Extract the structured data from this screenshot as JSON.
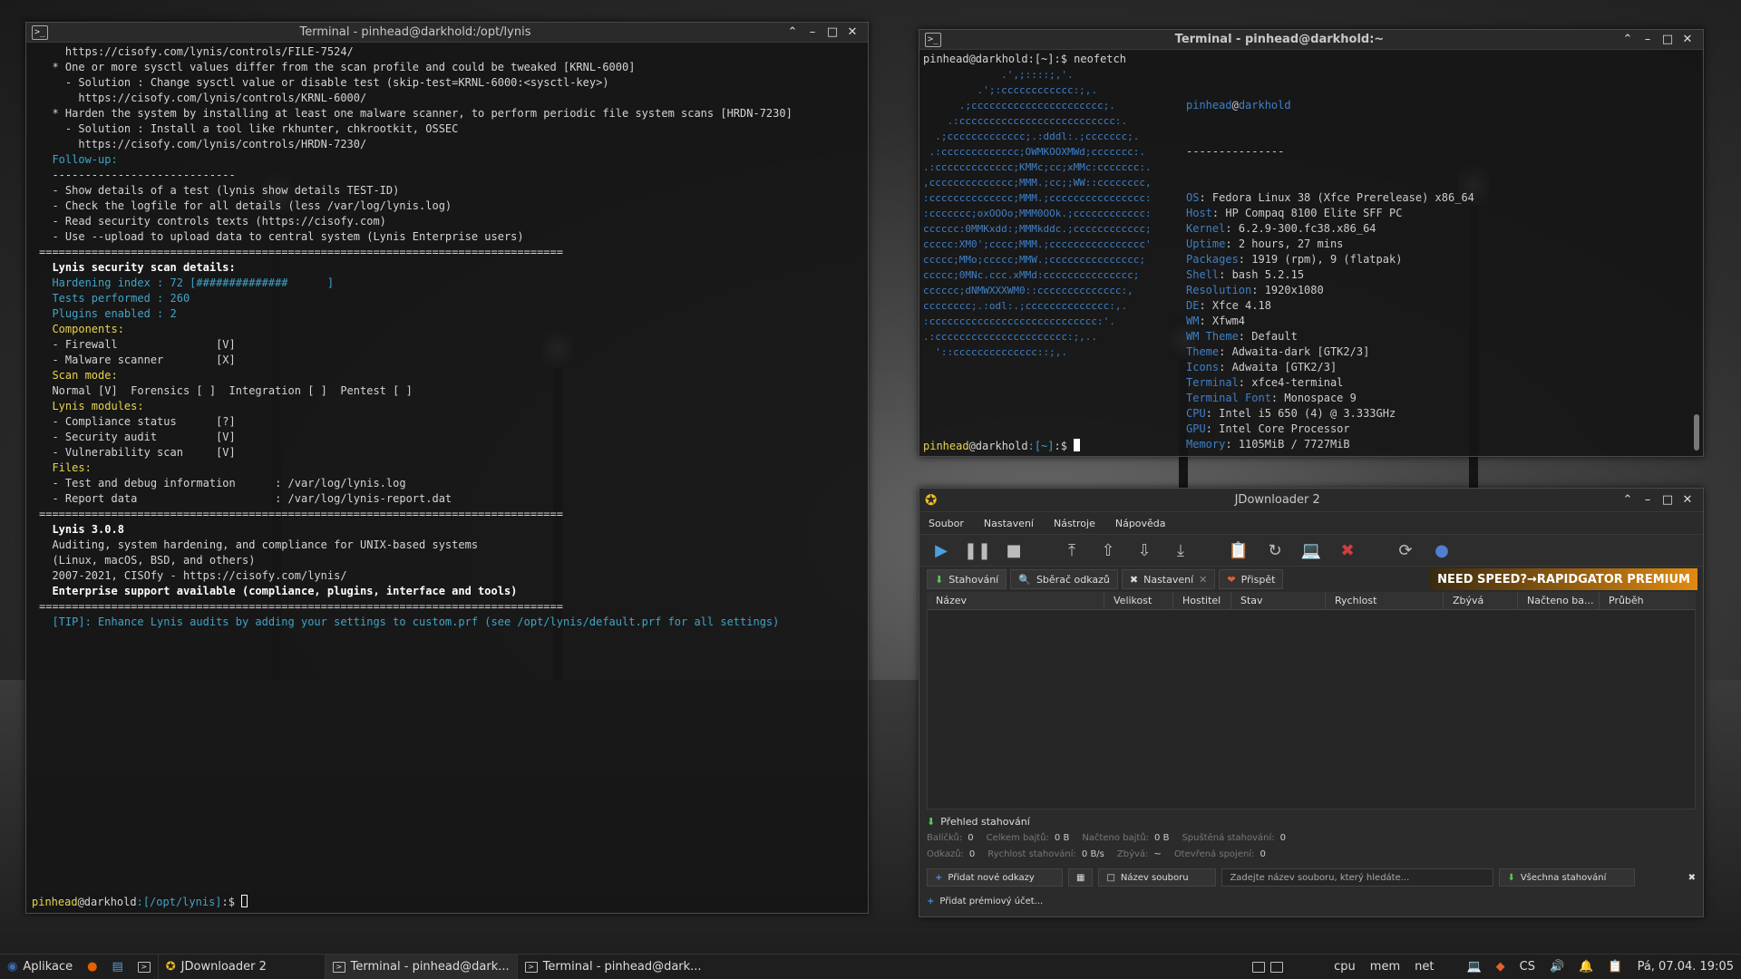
{
  "term_left": {
    "title": "Terminal - pinhead@darkhold:/opt/lynis",
    "lines": [
      "    https://cisofy.com/lynis/controls/FILE-7524/",
      "",
      "  * One or more sysctl values differ from the scan profile and could be tweaked [KRNL-6000]",
      "    - Solution : Change sysctl value or disable test (skip-test=KRNL-6000:<sysctl-key>)",
      "      https://cisofy.com/lynis/controls/KRNL-6000/",
      "",
      "  * Harden the system by installing at least one malware scanner, to perform periodic file system scans [HRDN-7230]",
      "    - Solution : Install a tool like rkhunter, chkrootkit, OSSEC",
      "      https://cisofy.com/lynis/controls/HRDN-7230/",
      "",
      "  Follow-up:",
      "  ----------------------------",
      "  - Show details of a test (lynis show details TEST-ID)",
      "  - Check the logfile for all details (less /var/log/lynis.log)",
      "  - Read security controls texts (https://cisofy.com)",
      "  - Use --upload to upload data to central system (Lynis Enterprise users)",
      "",
      "================================================================================",
      "",
      "  Lynis security scan details:",
      "",
      "  Hardening index : 72 [##############      ]",
      "  Tests performed : 260",
      "  Plugins enabled : 2",
      "",
      "  Components:",
      "  - Firewall               [V]",
      "  - Malware scanner        [X]",
      "",
      "  Scan mode:",
      "  Normal [V]  Forensics [ ]  Integration [ ]  Pentest [ ]",
      "",
      "  Lynis modules:",
      "  - Compliance status      [?]",
      "  - Security audit         [V]",
      "  - Vulnerability scan     [V]",
      "",
      "  Files:",
      "  - Test and debug information      : /var/log/lynis.log",
      "  - Report data                     : /var/log/lynis-report.dat",
      "",
      "================================================================================",
      "",
      "  Lynis 3.0.8",
      "",
      "  Auditing, system hardening, and compliance for UNIX-based systems",
      "  (Linux, macOS, BSD, and others)",
      "",
      "  2007-2021, CISOfy - https://cisofy.com/lynis/",
      "  Enterprise support available (compliance, plugins, interface and tools)",
      "",
      "================================================================================",
      "",
      "  [TIP]: Enhance Lynis audits by adding your settings to custom.prf (see /opt/lynis/default.prf for all settings)"
    ],
    "prompt_user": "pinhead",
    "prompt_host": "@darkhold",
    "prompt_path": ":[/opt/lynis]",
    "prompt_symbol": ":$ "
  },
  "term_right": {
    "title": "Terminal - pinhead@darkhold:~",
    "command_line": "pinhead@darkhold:[~]:$ neofetch",
    "logo_lines": [
      "             .',;::::;,'.",
      "         .';:cccccccccccc:;,.",
      "      .;cccccccccccccccccccccc;.",
      "    .:cccccccccccccccccccccccccc:.",
      "  .;ccccccccccccc;.:dddl:.;ccccccc;.",
      " .:ccccccccccccc;OWMKOOXMWd;ccccccc:.",
      ".:ccccccccccccc;KMMc;cc;xMMc:ccccccc:.",
      ",cccccccccccccc;MMM.;cc;;WW::cccccccc,",
      ":cccccccccccccc;MMM.;cccccccccccccccc:",
      ":ccccccc;oxOOOo;MMM0OOk.;cccccccccccc:",
      "cccccc:0MMKxdd:;MMMkddc.;cccccccccccc;",
      "ccccc:XM0';cccc;MMM.;cccccccccccccccc'",
      "ccccc;MMo;ccccc;MMW.;ccccccccccccccc;",
      "ccccc;0MNc.ccc.xMMd:ccccccccccccccc;",
      "cccccc;dNMWXXXWM0::cccccccccccccc:,",
      "cccccccc;.:odl:.;cccccccccccccc:,.",
      ":cccccccccccccccccccccccccccc:'.",
      ".:cccccccccccccccccccccc:;,..",
      "  '::cccccccccccccc::;,."
    ],
    "user": "pinhead",
    "host": "darkhold",
    "separator": "---------------",
    "info": [
      {
        "k": "OS",
        "v": "Fedora Linux 38 (Xfce Prerelease) x86_64"
      },
      {
        "k": "Host",
        "v": "HP Compaq 8100 Elite SFF PC"
      },
      {
        "k": "Kernel",
        "v": "6.2.9-300.fc38.x86_64"
      },
      {
        "k": "Uptime",
        "v": "2 hours, 27 mins"
      },
      {
        "k": "Packages",
        "v": "1919 (rpm), 9 (flatpak)"
      },
      {
        "k": "Shell",
        "v": "bash 5.2.15"
      },
      {
        "k": "Resolution",
        "v": "1920x1080"
      },
      {
        "k": "DE",
        "v": "Xfce 4.18"
      },
      {
        "k": "WM",
        "v": "Xfwm4"
      },
      {
        "k": "WM Theme",
        "v": "Default"
      },
      {
        "k": "Theme",
        "v": "Adwaita-dark [GTK2/3]"
      },
      {
        "k": "Icons",
        "v": "Adwaita [GTK2/3]"
      },
      {
        "k": "Terminal",
        "v": "xfce4-terminal"
      },
      {
        "k": "Terminal Font",
        "v": "Monospace 9"
      },
      {
        "k": "CPU",
        "v": "Intel i5 650 (4) @ 3.333GHz"
      },
      {
        "k": "GPU",
        "v": "Intel Core Processor"
      },
      {
        "k": "Memory",
        "v": "1105MiB / 7727MiB"
      }
    ],
    "swatches_top": [
      "#000000",
      "#cc0000",
      "#4e9a06",
      "#c4a000",
      "#3465a4",
      "#75507b",
      "#06989a",
      "#d3d7cf"
    ],
    "swatches_bottom": [
      "#555753",
      "#ef2929",
      "#8ae234",
      "#fce94f",
      "#729fcf",
      "#ad7fa8",
      "#34e2e2",
      "#eeeeec"
    ],
    "prompt_user": "pinhead",
    "prompt_host": "@darkhold",
    "prompt_path": ":[~]",
    "prompt_symbol": ":$ "
  },
  "jd": {
    "title": "JDownloader 2",
    "menu": [
      "Soubor",
      "Nastavení",
      "Nástroje",
      "Nápověda"
    ],
    "tabs": [
      "Stahování",
      "Sběrač odkazů",
      "Nastavení",
      "Přispět"
    ],
    "promo": "NEED SPEED?→RAPIDGATOR PREMIUM",
    "columns": [
      "Název",
      "Velikost",
      "Hostitel",
      "Stav",
      "Rychlost",
      "Zbývá",
      "Načteno ba...",
      "Průběh"
    ],
    "overview_title": "Přehled stahování",
    "stats_row1": [
      {
        "label": "Balíčků:",
        "value": "0"
      },
      {
        "label": "Celkem bajtů:",
        "value": "0 B"
      },
      {
        "label": "Načteno bajtů:",
        "value": "0 B"
      },
      {
        "label": "Spuštěná stahování:",
        "value": "0"
      }
    ],
    "stats_row2": [
      {
        "label": "Odkazů:",
        "value": "0"
      },
      {
        "label": "Rychlost stahování:",
        "value": "0 B/s"
      },
      {
        "label": "Zbývá:",
        "value": "~"
      },
      {
        "label": "Otevřená spojení:",
        "value": "0"
      }
    ],
    "add_links": "Přidat nové odkazy",
    "filename_label": "Název souboru",
    "search_placeholder": "Zadejte název souboru, který hledáte...",
    "all_downloads": "Všechna stahování",
    "add_premium": "Přidat prémiový účet..."
  },
  "taskbar": {
    "apps_label": "Aplikace",
    "tasks": [
      "JDownloader 2",
      "Terminal - pinhead@dark...",
      "Terminal - pinhead@dark..."
    ],
    "monitors": [
      "cpu",
      "mem",
      "net"
    ],
    "lang": "CS",
    "clock": "Pá, 07.04. 19:05"
  }
}
